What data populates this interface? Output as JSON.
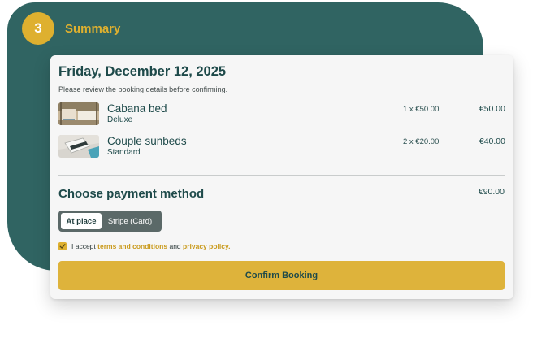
{
  "step": {
    "number": "3",
    "title": "Summary"
  },
  "booking": {
    "date_title": "Friday, December 12, 2025",
    "subtitle": "Please review the booking details before confirming.",
    "items": [
      {
        "name": "Cabana bed",
        "variant": "Deluxe",
        "qty_price": "1 x €50.00",
        "total": "€50.00",
        "thumb": "cabana-photo"
      },
      {
        "name": "Couple sunbeds",
        "variant": "Standard",
        "qty_price": "2 x €20.00",
        "total": "€40.00",
        "thumb": "sunbeds-photo"
      }
    ],
    "grand_total": "€90.00"
  },
  "payment": {
    "heading": "Choose payment method",
    "options": [
      {
        "label": "At place",
        "selected": true
      },
      {
        "label": "Stripe (Card)",
        "selected": false
      }
    ]
  },
  "terms": {
    "prefix": "I accept ",
    "terms_link": "terms and conditions",
    "middle": " and ",
    "privacy_link": "privacy policy.",
    "checked": true
  },
  "confirm_label": "Confirm Booking",
  "colors": {
    "panel": "#306462",
    "accent": "#deb02f",
    "text_dark": "#1e4a4a"
  }
}
